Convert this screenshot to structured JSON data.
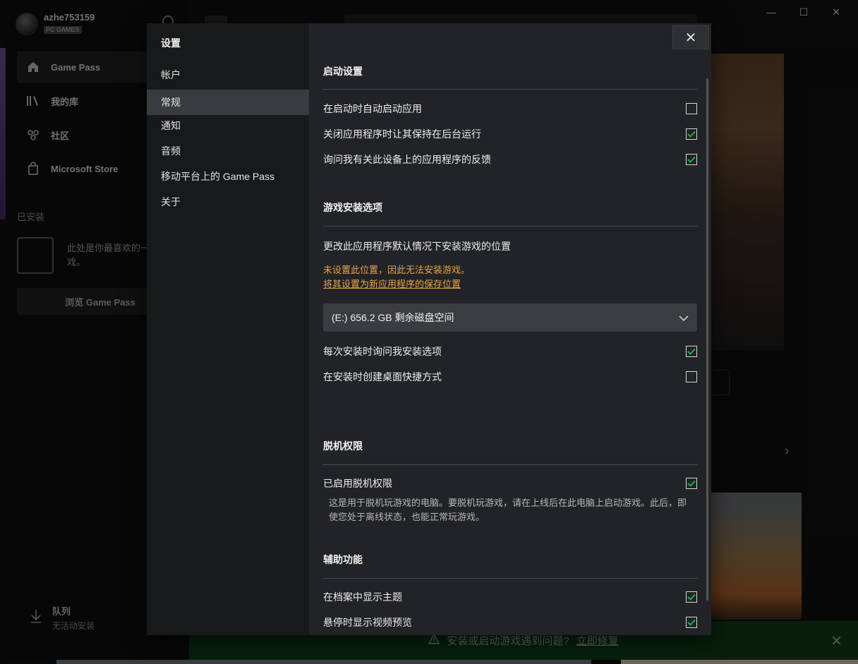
{
  "background": {
    "profile": {
      "name": "azhe753159",
      "tag": "PC GAMES"
    },
    "nav": [
      {
        "label": "Game Pass",
        "icon": "home-icon",
        "active": true
      },
      {
        "label": "我的库",
        "icon": "library-icon",
        "active": false
      },
      {
        "label": "社区",
        "icon": "community-icon",
        "active": false
      },
      {
        "label": "Microsoft Store",
        "icon": "store-icon",
        "active": false
      }
    ],
    "installed_heading": "已安装",
    "empty_text": "此处是你最喜欢的一款游戏。",
    "browse_button": "浏览 Game Pass",
    "queue": {
      "title": "队列",
      "subtitle": "无活动安装"
    },
    "banner": {
      "text": "安装或启动游戏遇到问题?",
      "link": "立即修复"
    },
    "window_controls": {
      "minimize": "—",
      "maximize": "☐",
      "close": "✕"
    }
  },
  "dialog": {
    "title": "设置",
    "nav": [
      {
        "label": "帐户",
        "active": false
      },
      {
        "label": "常规",
        "active": true
      },
      {
        "label": "通知",
        "active": false
      },
      {
        "label": "音频",
        "active": false
      },
      {
        "label": "移动平台上的 Game Pass",
        "active": false
      },
      {
        "label": "关于",
        "active": false
      }
    ],
    "close_glyph": "✕",
    "startup": {
      "title": "启动设置",
      "options": [
        {
          "label": "在启动时自动启动应用",
          "checked": false
        },
        {
          "label": "关闭应用程序时让其保持在后台运行",
          "checked": true
        },
        {
          "label": "询问我有关此设备上的应用程序的反馈",
          "checked": true
        }
      ]
    },
    "install": {
      "title": "游戏安装选项",
      "location_label": "更改此应用程序默认情况下安装游戏的位置",
      "warning": "未设置此位置，因此无法安装游戏。",
      "warning_link": "将其设置为新应用程序的保存位置",
      "drive_selected": "(E:) 656.2 GB 剩余磁盘空间",
      "options": [
        {
          "label": "每次安装时询问我安装选项",
          "checked": true
        },
        {
          "label": "在安装时创建桌面快捷方式",
          "checked": false
        }
      ]
    },
    "offline": {
      "title": "脱机权限",
      "option": {
        "label": "已启用脱机权限",
        "checked": true
      },
      "description": "这是用于脱机玩游戏的电脑。要脱机玩游戏，请在上线后在此电脑上启动游戏。此后，即使您处于离线状态，也能正常玩游戏。"
    },
    "accessibility": {
      "title": "辅助功能",
      "options": [
        {
          "label": "在档案中显示主题",
          "checked": true
        },
        {
          "label": "悬停时显示视频预览",
          "checked": true
        }
      ]
    }
  },
  "colors": {
    "check_green": "#1db954",
    "warning_orange": "#e8a24a",
    "banner_green": "#0e3a17"
  }
}
